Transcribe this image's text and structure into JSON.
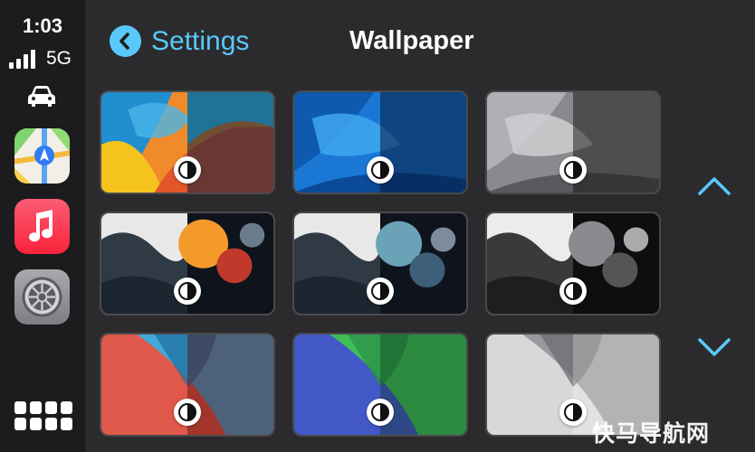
{
  "status": {
    "time": "1:03",
    "network": "5G",
    "signal_bars": 4
  },
  "sidebar": {
    "apps": [
      {
        "name": "Maps",
        "icon": "maps-icon"
      },
      {
        "name": "Music",
        "icon": "music-icon"
      },
      {
        "name": "Settings",
        "icon": "settings-gear-icon"
      }
    ],
    "now_playing_icon": "car-icon",
    "dashboard_icon": "app-grid-icon"
  },
  "header": {
    "back_label": "Settings",
    "title": "Wallpaper"
  },
  "wallpapers": [
    {
      "style": "color-orange-blue"
    },
    {
      "style": "blue"
    },
    {
      "style": "gray"
    },
    {
      "style": "blob-orange"
    },
    {
      "style": "blob-blue"
    },
    {
      "style": "blob-gray"
    },
    {
      "style": "red"
    },
    {
      "style": "blue-green"
    },
    {
      "style": "silver"
    }
  ],
  "scroll": {
    "up_icon": "chevron-up-icon",
    "down_icon": "chevron-down-icon"
  },
  "watermark": "快马导航网",
  "colors": {
    "accent": "#5ac8fa",
    "sidebar": "#1c1c1e",
    "background": "#2b2b2d"
  }
}
